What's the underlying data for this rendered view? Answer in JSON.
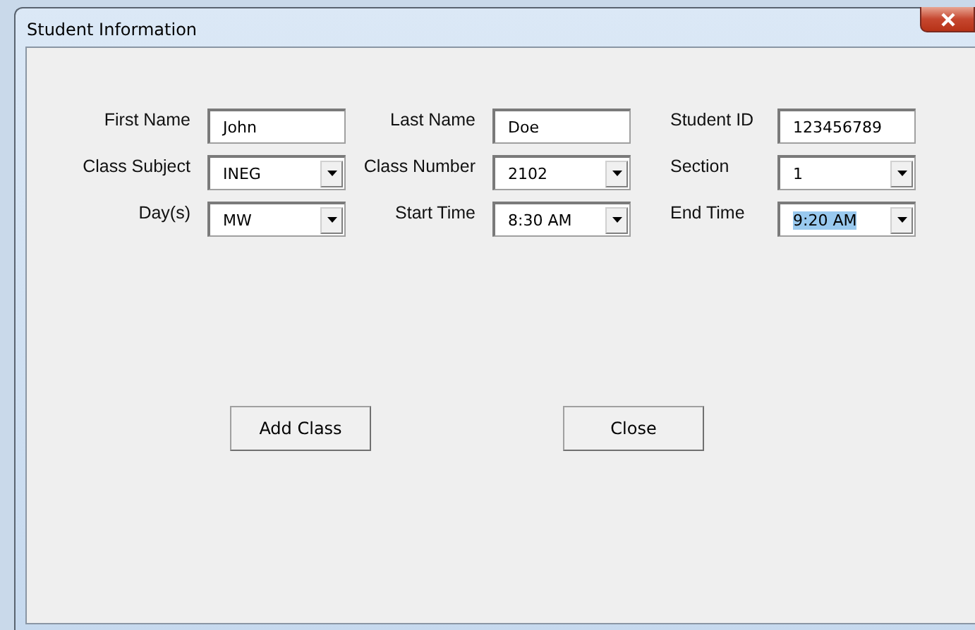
{
  "window": {
    "title": "Student Information"
  },
  "form_rows": [
    {
      "fields": [
        {
          "kind": "text",
          "label": "First Name",
          "value": "John",
          "selected": false
        },
        {
          "kind": "text",
          "label": "Last Name",
          "value": "Doe",
          "selected": false
        },
        {
          "kind": "text",
          "label": "Student ID",
          "value": "123456789",
          "selected": false
        }
      ]
    },
    {
      "fields": [
        {
          "kind": "combo",
          "label": "Class Subject",
          "value": "INEG",
          "selected": false
        },
        {
          "kind": "combo",
          "label": "Class Number",
          "value": "2102",
          "selected": false
        },
        {
          "kind": "combo",
          "label": "Section",
          "value": "1",
          "selected": false
        }
      ]
    },
    {
      "fields": [
        {
          "kind": "combo",
          "label": "Day(s)",
          "value": "MW",
          "selected": false
        },
        {
          "kind": "combo",
          "label": "Start Time",
          "value": "8:30 AM",
          "selected": false
        },
        {
          "kind": "combo",
          "label": "End Time",
          "value": "9:20 AM",
          "selected": true
        }
      ]
    }
  ],
  "buttons": [
    {
      "label": "Add Class"
    },
    {
      "label": "Close"
    }
  ]
}
